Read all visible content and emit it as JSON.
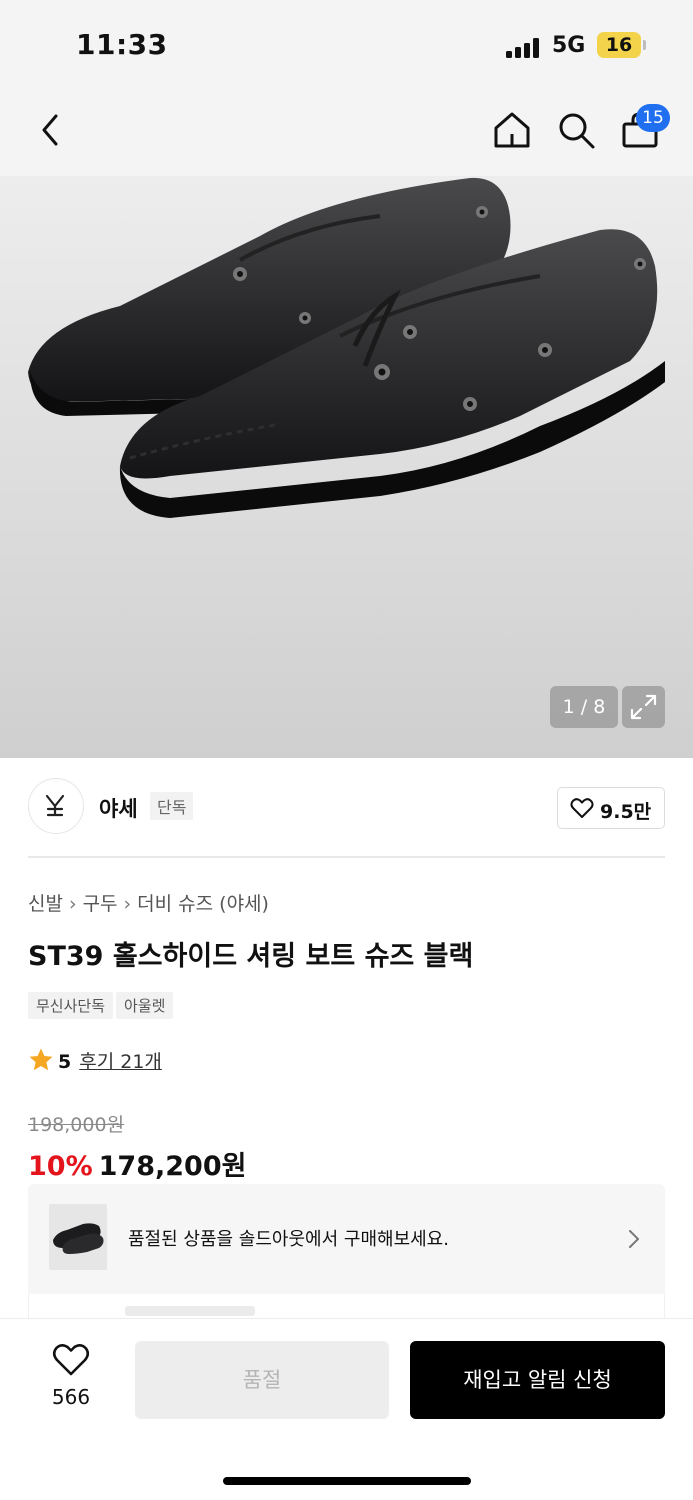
{
  "status_bar": {
    "time": "11:33",
    "network": "5G",
    "battery": "16"
  },
  "nav": {
    "cart_count": "15",
    "icons": [
      "back-arrow-icon",
      "home-icon",
      "search-icon",
      "shopping-bag-icon"
    ]
  },
  "hero": {
    "counter": "1 / 8",
    "description": "black leather boat shoes pair"
  },
  "brand": {
    "name": "야세",
    "tag": "단독",
    "likes": "9.5만"
  },
  "breadcrumb": [
    "신발",
    "구두",
    "더비 슈즈 (야세)"
  ],
  "product": {
    "title": "ST39 홀스하이드 셔링 보트 슈즈 블랙",
    "tags": [
      "무신사단독",
      "아울렛"
    ],
    "rating": "5",
    "reviews": "후기 21개",
    "original_price": "198,000원",
    "discount": "10%",
    "price": "178,200원"
  },
  "soldout_card": {
    "text": "품절된 상품을 솔드아웃에서 구매해보세요."
  },
  "bottom_bar": {
    "wish_count": "566",
    "soldout_label": "품절",
    "restock_label": "재입고 알림 신청"
  },
  "colors": {
    "accent_red": "#e3141c",
    "badge_blue": "#1f6ff0",
    "star": "#f5a623"
  }
}
